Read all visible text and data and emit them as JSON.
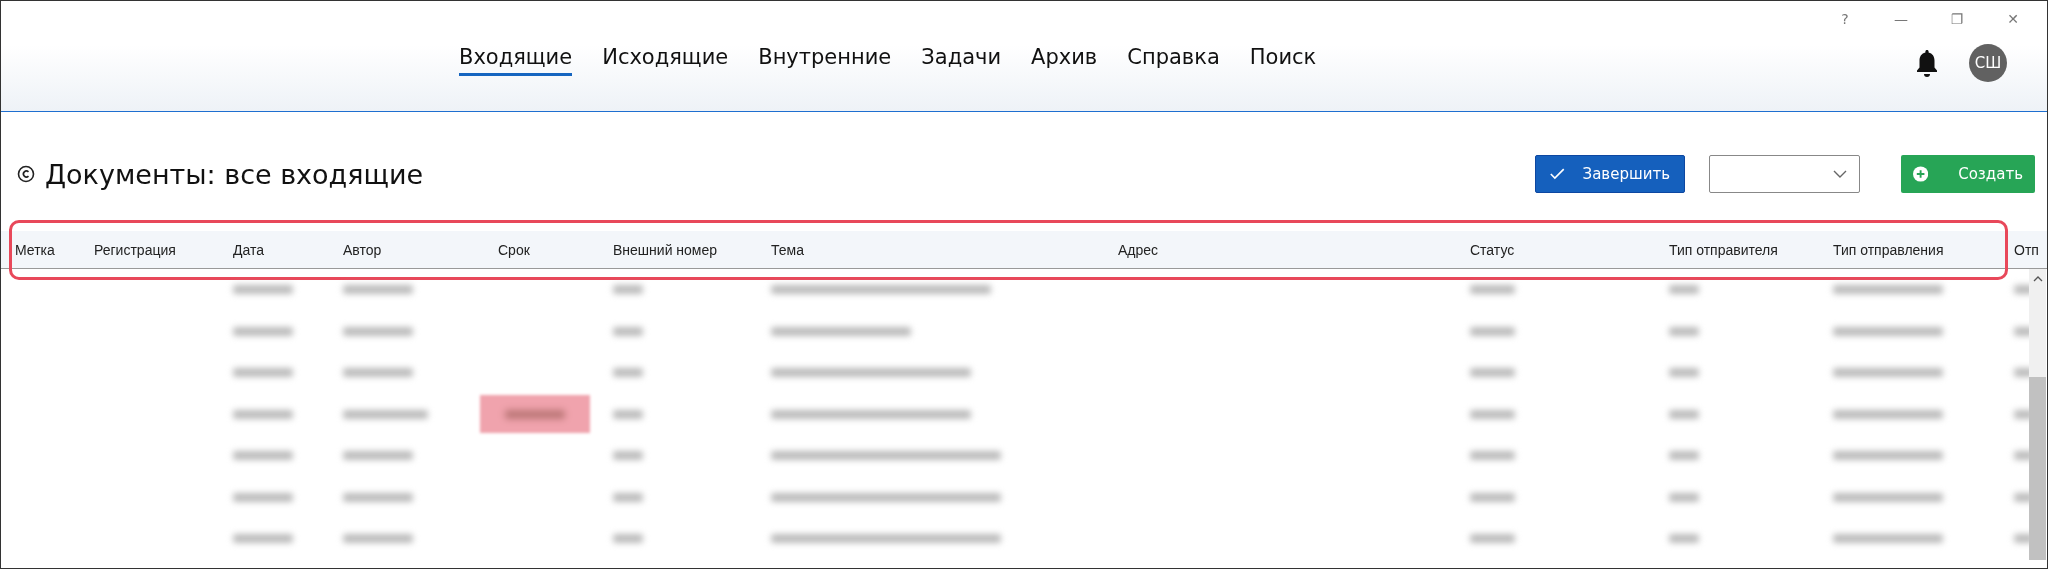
{
  "window_controls": [
    "?",
    "—",
    "❐",
    "✕"
  ],
  "nav": {
    "tabs": [
      {
        "label": "Входящие",
        "selected": true
      },
      {
        "label": "Исходящие",
        "selected": false
      },
      {
        "label": "Внутренние",
        "selected": false
      },
      {
        "label": "Задачи",
        "selected": false
      },
      {
        "label": "Архив",
        "selected": false
      },
      {
        "label": "Справка",
        "selected": false
      },
      {
        "label": "Поиск",
        "selected": false
      }
    ],
    "avatar": "СШ"
  },
  "page": {
    "title": "Документы: все входящие",
    "finish_button": "Завершить",
    "create_button": "Создать"
  },
  "table": {
    "header_highlighted": true,
    "columns": [
      "Метка",
      "Регистрация",
      "Дата",
      "Автор",
      "Срок",
      "Внешний номер",
      "Тема",
      "Адрес",
      "Статус",
      "Тип отправителя",
      "Тип отправления",
      "Отп"
    ],
    "rows": [
      {
        "overdue": false
      },
      {
        "overdue": false
      },
      {
        "overdue": false
      },
      {
        "overdue": true
      },
      {
        "overdue": false
      },
      {
        "overdue": false
      },
      {
        "overdue": false
      }
    ]
  }
}
